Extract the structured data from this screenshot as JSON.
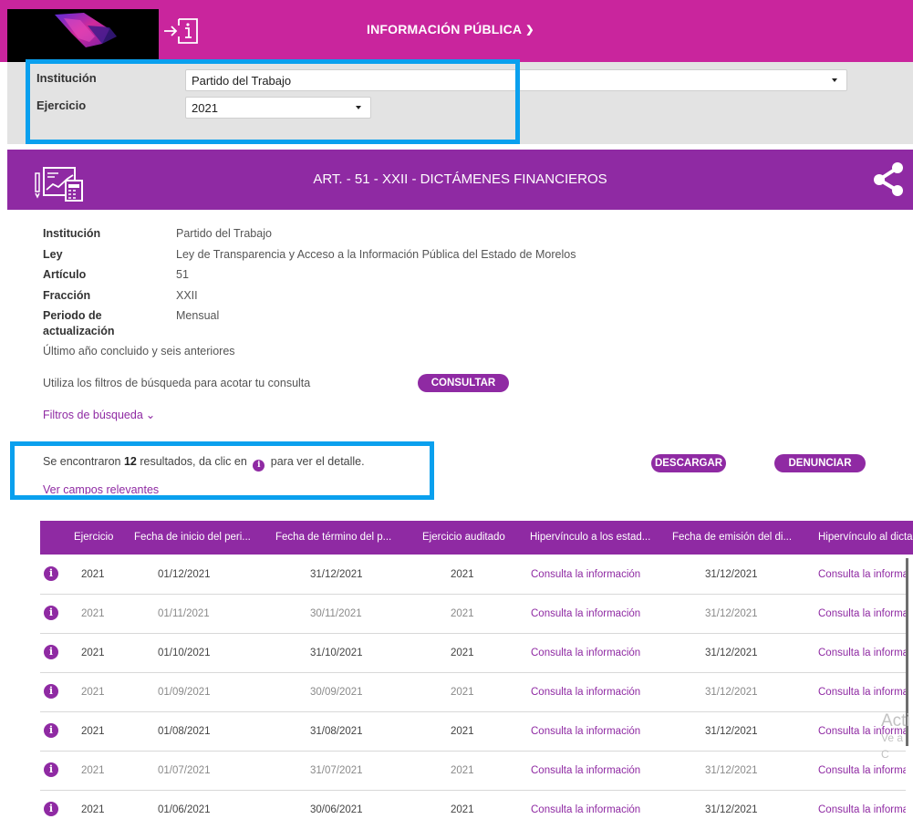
{
  "header": {
    "title": "INFORMACIÓN PÚBLICA",
    "chevron": "chevron-down-icon"
  },
  "filters": {
    "institucion_label": "Institución",
    "institucion_value": "Partido del Trabajo",
    "ejercicio_label": "Ejercicio",
    "ejercicio_value": "2021"
  },
  "banner": {
    "title": "ART. - 51 - XXII - DICTÁMENES FINANCIEROS"
  },
  "meta": {
    "institucion_label": "Institución",
    "institucion_value": "Partido del Trabajo",
    "ley_label": "Ley",
    "ley_value": "Ley de Transparencia y Acceso a la Información Pública del Estado de Morelos",
    "articulo_label": "Artículo",
    "articulo_value": "51",
    "fraccion_label": "Fracción",
    "fraccion_value": "XXII",
    "periodo_label_1": "Periodo de",
    "periodo_label_2": "actualización",
    "periodo_value": "Mensual",
    "ultimo": "Último año concluido y seis anteriores",
    "utiliza": "Utiliza los filtros de búsqueda para acotar tu consulta",
    "consultar": "CONSULTAR",
    "filtros": "Filtros de búsqueda"
  },
  "results": {
    "prefix": "Se encontraron",
    "count": "12",
    "middle": "resultados, da clic en",
    "suffix": "para ver el detalle.",
    "ver_campos": "Ver campos relevantes",
    "descargar": "DESCARGAR",
    "denunciar": "DENUNCIAR"
  },
  "table": {
    "headers": [
      "Ejercicio",
      "Fecha de inicio del peri...",
      "Fecha de término del p...",
      "Ejercicio auditado",
      "Hipervínculo a los estad...",
      "Fecha de emisión del di...",
      "Hipervínculo al dictamen"
    ],
    "rows": [
      [
        "2021",
        "01/12/2021",
        "31/12/2021",
        "2021",
        "Consulta la información",
        "31/12/2021",
        "Consulta la información"
      ],
      [
        "2021",
        "01/11/2021",
        "30/11/2021",
        "2021",
        "Consulta la información",
        "31/12/2021",
        "Consulta la información"
      ],
      [
        "2021",
        "01/10/2021",
        "31/10/2021",
        "2021",
        "Consulta la información",
        "31/12/2021",
        "Consulta la información"
      ],
      [
        "2021",
        "01/09/2021",
        "30/09/2021",
        "2021",
        "Consulta la información",
        "31/12/2021",
        "Consulta la información"
      ],
      [
        "2021",
        "01/08/2021",
        "31/08/2021",
        "2021",
        "Consulta la información",
        "31/12/2021",
        "Consulta la información"
      ],
      [
        "2021",
        "01/07/2021",
        "31/07/2021",
        "2021",
        "Consulta la información",
        "31/12/2021",
        "Consulta la información"
      ],
      [
        "2021",
        "01/06/2021",
        "30/06/2021",
        "2021",
        "Consulta la información",
        "31/12/2021",
        "Consulta la información"
      ]
    ]
  },
  "watermark": {
    "line1": "Acti",
    "line2": "Ve a C"
  },
  "colors": {
    "header_magenta": "#c9259d",
    "purple": "#8f2aa3",
    "highlight_blue": "#0aa0ee",
    "filter_gray": "#e3e3e3"
  }
}
